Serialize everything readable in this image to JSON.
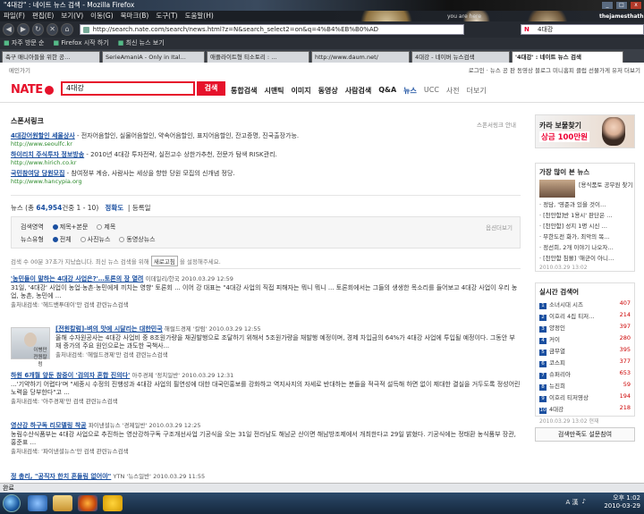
{
  "window": {
    "title": "\"4대강\" : 네이트 뉴스 검색 - Mozilla Firefox",
    "controls": [
      "_",
      "□",
      "x"
    ]
  },
  "menu": [
    "파일(F)",
    "편집(E)",
    "보기(V)",
    "이동(G)",
    "북마크(B)",
    "도구(T)",
    "도움말(H)"
  ],
  "theme": {
    "you_are_here": "you are here",
    "blog": "thejamesthathite"
  },
  "nav": {
    "url": "http://search.nate.com/search/news.html?z=N&search_select2=on&q=4%B4%EB%B0%AD",
    "search_value": "4대강"
  },
  "bookmarks": [
    "자주 방문 순",
    "Firefox 시작 하기",
    "최신 뉴스 보기"
  ],
  "tabs": [
    {
      "label": "축구 매니아들을 위한 공…",
      "active": false
    },
    {
      "label": "SerieAmaniA - Only in Ital…",
      "active": false
    },
    {
      "label": "애플라이트형 티소토리 : …",
      "active": false
    },
    {
      "label": "http://www.daum.net/",
      "active": false
    },
    {
      "label": "4대강 - 네이버 뉴스검색",
      "active": false
    },
    {
      "label": "'4대강' : 네이트 뉴스 검색",
      "active": true
    }
  ],
  "page": {
    "topline": "메인가기",
    "toplinks": "로그인 · 뉴스 공 판 동영상 블로그 미니홈피 클럽 선물가게 유저 더보기",
    "logo": "NATE",
    "query": "4대강",
    "search_btn": "검색",
    "categories": [
      {
        "label": "통합검색",
        "on": false,
        "light": false
      },
      {
        "label": "시맨틱",
        "on": false,
        "light": false
      },
      {
        "label": "이미지",
        "on": false,
        "light": false
      },
      {
        "label": "동영상",
        "on": false,
        "light": false
      },
      {
        "label": "사람검색",
        "on": false,
        "light": false
      },
      {
        "label": "Q&A",
        "on": false,
        "light": false
      },
      {
        "label": "뉴스",
        "on": true,
        "light": false
      },
      {
        "label": "UCC",
        "on": false,
        "light": true
      },
      {
        "label": "사전",
        "on": false,
        "light": true
      },
      {
        "label": "더보기",
        "on": false,
        "light": true
      }
    ],
    "sponsor_title": "스폰서링크",
    "sponsor_right": "스폰서링크 안내",
    "ads": [
      {
        "title": "4대강어원할인 세울상사",
        "desc": "- 전자어음할인, 실물어음할인, 약속어음할인, 표지어음할인, 잔고증명, 진국출장가능.",
        "url": "http://www.seoulfc.kr"
      },
      {
        "title": "하이리치 주식투자 정보방송",
        "desc": "- 2010년 4대강 투자전략, 실전고수 상한가추천, 전문가 탐색 RISK관리.",
        "url": "http://www.hirich.co.kr"
      },
      {
        "title": "국민참여당 당원모집",
        "desc": "- 참여정부 계승, 사람사는 세상을 향한 당원 모집의 신개념 정당.",
        "url": "http://www.hancypia.org"
      }
    ],
    "news_info": {
      "prefix": "뉴스 (총",
      "count": "64,954",
      "suffix": "건중 1 - 10)",
      "sort1": "정확도",
      "sort2": "등록일"
    },
    "filter": {
      "row1_label": "검색영역",
      "row1_opts": [
        {
          "label": "제목+본문",
          "on": true
        },
        {
          "label": "제목",
          "on": false
        }
      ],
      "row2_label": "뉴스유형",
      "row2_opts": [
        {
          "label": "전체",
          "on": true
        },
        {
          "label": "사진뉴스",
          "on": false
        },
        {
          "label": "동영상뉴스",
          "on": false
        }
      ],
      "option": "옵션더보기"
    },
    "note": {
      "before": "검색 수 00분 37초가 지났습니다. 최신 뉴스 검색을 위해",
      "select": "새로고침",
      "after": "을 설정해주세요."
    }
  },
  "articles": [
    {
      "title": "'농민들이 말하는 4대강 사업은?'…토론의 장 열려",
      "source": "이데일리/한국",
      "date": "2010.03.29 12:59",
      "body": "31일, '4대강' 사업이 농업·농촌·농민에게 끼치는 영향' 토론회 ... 이어 강 대표는 \"4대강 사업의 직접 피해자는 뭐니 뭐니 ... 토론회에서는 그들의 생생한 목소리를 들어보고 4대강 사업이 우리 농업, 농촌, 농민에 ...",
      "links": "출처내검색: '헤드밴투데이'만 검색  관련뉴스검색"
    },
    {
      "title": "[전원칼럼]-벼의 맛에 시달리는 대한민국",
      "source": "해럴드경제 '칼럼'",
      "date": "2010.03.29 12:55",
      "body": "올해 수자원공사는 4대강 사업비 중 8조원가량을 채권발행으로 조달하기 위해서 5조원가량을 채발행 예정이며, 경제 차입금의 64%가 4대강 사업에 투입될 예정이다. 그동안 부채 증가의 주요 원인으로는 과도한 국책사...",
      "links": "출처내검색: '헤럴드경제'만 검색  관련뉴스검색",
      "thumb_label": "이병만 전원칼럼"
    },
    {
      "title": "하원 6개월 앞둔 참중이 '검의자 혼합 진의다'",
      "source": "아주경제 '정치일반'",
      "date": "2010.03.29 12:31",
      "body": "...'기약하기 어렵다'며 \"세종시 수정의 진행성과 4대강 사업의 필연성에 대한 대국민홍보를 강화하고 역지사지의 자세로 반대하는 분들을 적극적 설득해 하면 없이 제대한 결실을 거두도록 정성어린 노력을 당부한다\"고 ...",
      "links": "출처내검색: '아주경제'만 검색  관련뉴스검색"
    },
    {
      "title": "영산강 하구독 리모델링 착공",
      "source": "파이낸셜뉴스 '경제일반'",
      "date": "2010.03.29 12:25",
      "body": "농림수산식품부는 4대강 사업으로 추진하는 영산강하구독 구조개선사업 기공식을 오는 31일 전라남도 해남군 산이면 해남방조제에서 개최한다고 29일 밝혔다. 기공식에는 정태환 농식품부 장관, 홍준표 ...",
      "links": "출처내검색: '파이낸셜뉴스'만 검색  관련뉴스검색"
    },
    {
      "title": "정 총리, \"공직자 한치 흔들림 없어야\"",
      "source": "YTN '뉴스일반'",
      "date": "2010.03.29 11:55",
      "body": "",
      "links": ""
    }
  ],
  "side": {
    "ad_line1": "카라 보물찾기",
    "ad_line2": "상금 100만원",
    "popular_title": "가장 많이 본 뉴스",
    "popular": [
      "[용식품토 공무원 찾기 원빈]",
      "· 정담, '영준과 있을 것이…",
      "· [천안함]반 1용시' 판단은 …",
      "· [천안함] 성지 1명 시신 …",
      "· 무한도전 화가, 최악의 복…",
      "· 정선희, 2개 이야기 나오자…",
      "· [천안함 침몰] '해군이 아니…"
    ],
    "popular_date": "2010.03.29 13:02",
    "realtime_title": "실시간 검색어",
    "realtime": [
      {
        "label": "소녀시대 시즈",
        "count": "407"
      },
      {
        "label": "이호리 4집 티저…",
        "count": "214"
      },
      {
        "label": "양정인",
        "count": "397"
      },
      {
        "label": "커이",
        "count": "280"
      },
      {
        "label": "금무열",
        "count": "395"
      },
      {
        "label": "코스피",
        "count": "377"
      },
      {
        "label": "슈퍼리아",
        "count": "653"
      },
      {
        "label": "뉴진희",
        "count": "59"
      },
      {
        "label": "이호리 티저영상",
        "count": "194"
      },
      {
        "label": "4대강",
        "count": "218"
      }
    ],
    "realtime_date": "2010.03.29 13:02 현재",
    "feedback": "검색만족도 설문참여"
  },
  "status": "완료",
  "taskbar": {
    "time": "오후 1:02",
    "date": "2010-03-29",
    "ime": "A 漢"
  },
  "colors": {
    "brand": "#e6122b",
    "link": "#1a4fa0"
  }
}
